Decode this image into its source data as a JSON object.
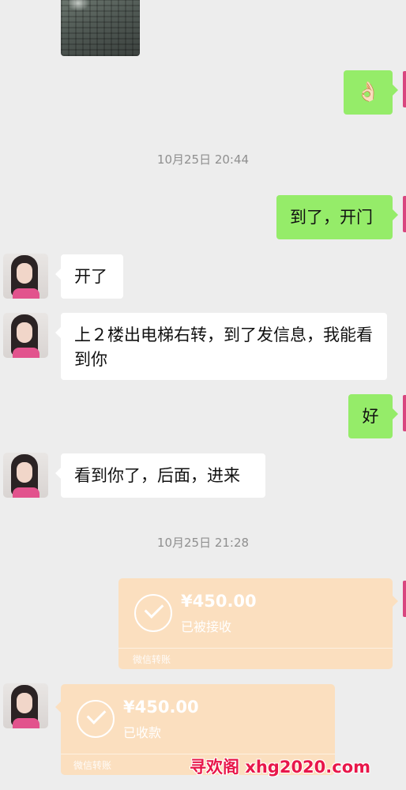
{
  "messages": {
    "m1_emoji": "👌🏻",
    "time1": "10月25日 20:44",
    "m2": "到了，开门",
    "m3": "开了",
    "m4": "上２楼出电梯右转，到了发信息，我能看到你",
    "m5": "好",
    "m6": "看到你了，后面，进来",
    "time2": "10月25日 21:28"
  },
  "transfers": {
    "sent": {
      "amount": "¥450.00",
      "status": "已被接收",
      "source": "微信转账"
    },
    "received": {
      "amount": "¥450.00",
      "status": "已收款",
      "source": "微信转账"
    }
  },
  "watermark": "寻欢阁 xhg2020.com",
  "colors": {
    "background": "#ededed",
    "out_bubble": "#95ec69",
    "in_bubble": "#ffffff",
    "transfer_card": "#fbdfbf",
    "watermark": "#e8174a"
  }
}
